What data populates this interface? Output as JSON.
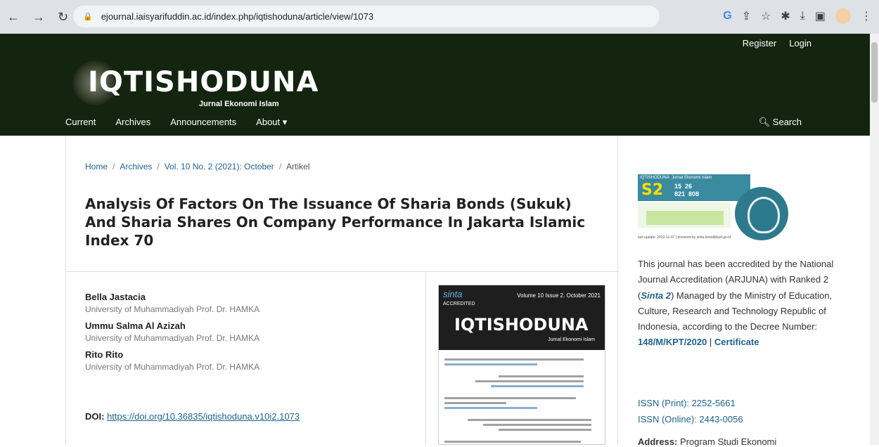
{
  "browser": {
    "url": "ejournal.iaisyarifuddin.ac.id/index.php/iqtishoduna/article/view/1073"
  },
  "header": {
    "register": "Register",
    "login": "Login",
    "logo_name": "IQTISHODUNA",
    "logo_sub": "Jurnal Ekonomi Islam",
    "nav": [
      "Current",
      "Archives",
      "Announcements",
      "About ▾"
    ],
    "search": "Search"
  },
  "breadcrumb": {
    "home": "Home",
    "archives": "Archives",
    "issue": "Vol. 10 No. 2 (2021): October",
    "current": "Artikel"
  },
  "article": {
    "title": "Analysis Of Factors On The Issuance Of Sharia Bonds (Sukuk) And Sharia Shares On Company Performance In Jakarta Islamic Index 70",
    "authors": [
      {
        "name": "Bella Jastacia",
        "affiliation": "University of Muhammadiyah Prof. Dr. HAMKA"
      },
      {
        "name": "Ummu Salma Al Azizah",
        "affiliation": "University of Muhammadiyah Prof. Dr. HAMKA"
      },
      {
        "name": "Rito Rito",
        "affiliation": "University of Muhammadiyah Prof. Dr. HAMKA"
      }
    ],
    "doi_label": "DOI:",
    "doi_url": "https://doi.org/10.36835/iqtishoduna.v10i2.1073"
  },
  "cover": {
    "sinta": "sinta",
    "accredited": "ACCREDITED",
    "volume": "Volume 10 Issue 2. October 2021",
    "name": "IQTISHODUNA",
    "sub": "Jurnal Ekonomi Islam"
  },
  "sidebar": {
    "badge_title": "IQTISHODUNA: Jurnal Ekonomi Islam",
    "badge_rank": "S2",
    "badge_nums": [
      "15",
      "26",
      "821",
      "808"
    ],
    "badge_update": "last update: 2022-11-07 | powered by sinta.kemdikbud.go.id",
    "accreditation_text": "This journal has been accredited by the National Journal Accreditation (ARJUNA) with Ranked 2 (",
    "sinta_label": "Sinta 2",
    "accreditation_text2": ") Managed by the Ministry of Education, Culture, Research and Technology Republic of Indonesia, according to the Decree Number: ",
    "decree": "148/M/KPT/2020",
    "sep": " | ",
    "certificate": "Certificate",
    "issn_print": "ISSN (Print): 2252-5661",
    "issn_online": "ISSN (Online): 2443-0056",
    "address_label": "Address:",
    "address_value": "Program Studi Ekonomi"
  }
}
